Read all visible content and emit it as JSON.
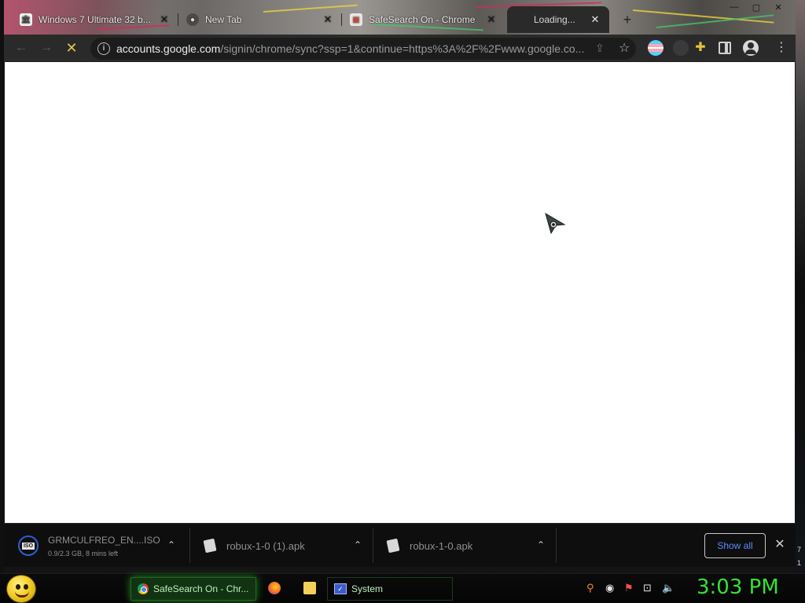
{
  "browser": {
    "tabs": [
      {
        "title": "Windows 7 Ultimate 32 b...",
        "favicon": "museum-icon",
        "active": false
      },
      {
        "title": "New Tab",
        "favicon": "github-icon",
        "active": false
      },
      {
        "title": "SafeSearch On - Chrome",
        "favicon": "tab-favicon-icon",
        "active": false
      },
      {
        "title": "Loading...",
        "favicon": "",
        "active": true
      }
    ],
    "new_tab": "+",
    "close_glyph": "✕",
    "window_controls": {
      "minimize": "—",
      "maximize": "▢",
      "close": "✕"
    },
    "toolbar": {
      "back": "←",
      "forward": "→",
      "stop": "✕",
      "url_host": "accounts.google.com",
      "url_path": "/signin/chrome/sync?ssp=1&continue=https%3A%2F%2Fwww.google.co...",
      "info": "i",
      "star": "☆",
      "share": "⇪",
      "puzzle": "✚",
      "menu": "⋮"
    }
  },
  "downloads": {
    "items": [
      {
        "name": "GRMCULFREO_EN....ISO",
        "status": "0.9/2.3 GB, 8 mins left",
        "icon": "iso-icon",
        "badge": "ISO"
      },
      {
        "name": "robux-1-0 (1).apk",
        "icon": "file-icon"
      },
      {
        "name": "robux-1-0.apk",
        "icon": "file-icon"
      }
    ],
    "chevron": "⌃",
    "show_all": "Show all",
    "close": "✕"
  },
  "taskbar": {
    "items": [
      {
        "label": "SafeSearch On - Chr...",
        "icon": "chrome-icon",
        "active": true
      },
      {
        "label": "System",
        "icon": "system-icon",
        "active": false
      }
    ],
    "clock": "3:03 PM",
    "tray": {
      "search": "⚲",
      "chat": "◉",
      "flag": "⚑",
      "network": "⊡",
      "volume": "🔈"
    }
  },
  "desktop": {
    "edge_marks": [
      "7",
      "1"
    ]
  },
  "colors": {
    "accent": "#35e035",
    "link": "#5b8cff",
    "stop": "#e2c64a"
  }
}
